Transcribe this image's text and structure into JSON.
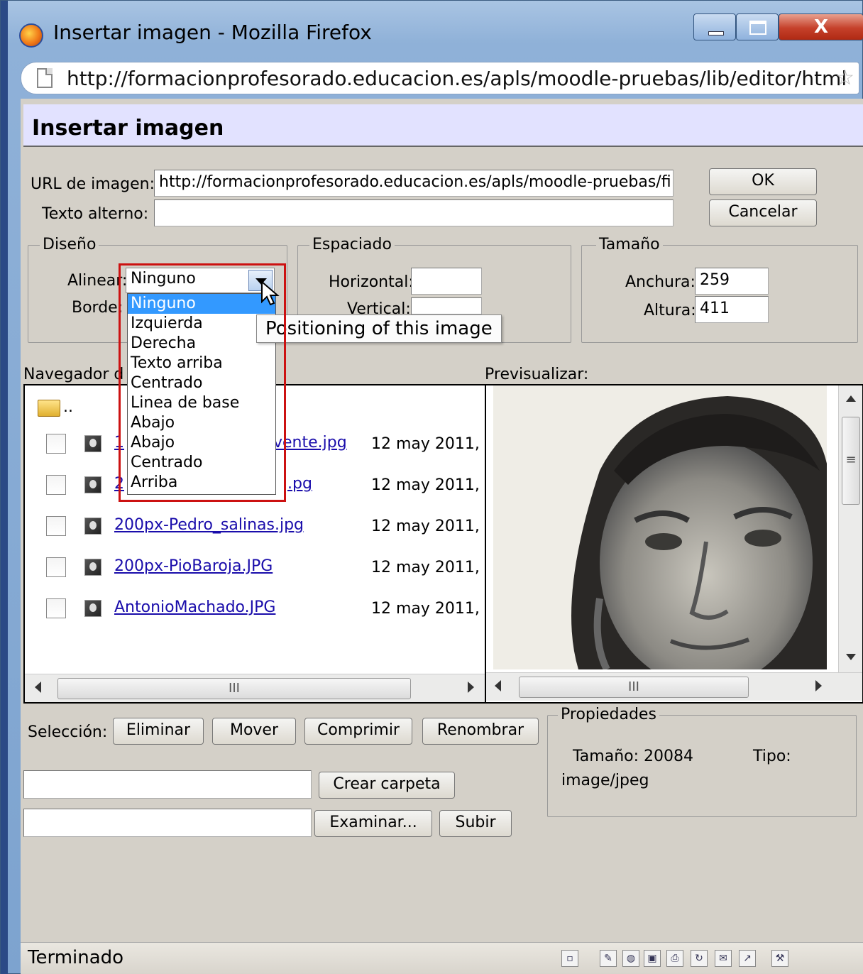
{
  "window": {
    "title": "Insertar imagen - Mozilla Firefox",
    "minimize_label": "",
    "maximize_label": "",
    "close_label": "X"
  },
  "urlbar": {
    "url": "http://formacionprofesorado.educacion.es/apls/moodle-pruebas/lib/editor/html"
  },
  "dialog": {
    "title": "Insertar imagen",
    "url_label": "URL de imagen:",
    "url_value": "http://formacionprofesorado.educacion.es/apls/moodle-pruebas/fi",
    "alt_label": "Texto alterno:",
    "alt_value": "",
    "ok_label": "OK",
    "cancel_label": "Cancelar"
  },
  "diseno": {
    "legend": "Diseño",
    "align_label": "Alinear:",
    "align_value": "Ninguno",
    "border_label": "Borde:",
    "align_options": [
      "Ninguno",
      "Izquierda",
      "Derecha",
      "Texto arriba",
      "Centrado",
      "Linea de base",
      "Abajo",
      "Abajo",
      "Centrado",
      "Arriba"
    ],
    "selected_option": "Ninguno"
  },
  "tooltip": "Positioning of this image",
  "espaciado": {
    "legend": "Espaciado",
    "horizontal_label": "Horizontal:",
    "vertical_label": "Vertical:",
    "horizontal_value": "",
    "vertical_value": ""
  },
  "tamano": {
    "legend": "Tamaño",
    "width_label": "Anchura:",
    "width_value": "259",
    "height_label": "Altura:",
    "height_value": "411"
  },
  "browser": {
    "label": "Navegador d",
    "parent_dir": "..",
    "files": [
      {
        "name_visible": "1",
        "name_tail": "vente.jpg",
        "date": "12 may 2011,"
      },
      {
        "name_visible": "2",
        "name_tail": ".pg",
        "date": "12 may 2011,"
      },
      {
        "name_visible": "200px-Pedro_salinas.jpg",
        "name_tail": "",
        "date": "12 may 2011,"
      },
      {
        "name_visible": "200px-PioBaroja.JPG",
        "name_tail": "",
        "date": "12 may 2011,"
      },
      {
        "name_visible": "AntonioMachado.JPG",
        "name_tail": "",
        "date": "12 may 2011,"
      }
    ],
    "scroll_grip": "III"
  },
  "preview": {
    "label": "Previsualizar:",
    "scroll_grip": "III",
    "vscroll_grip": "≡"
  },
  "seleccion": {
    "label": "Selección:",
    "delete": "Eliminar",
    "move": "Mover",
    "compress": "Comprimir",
    "rename": "Renombrar"
  },
  "propiedades": {
    "legend": "Propiedades",
    "size_label": "Tamaño: 20084",
    "type_label": "Tipo:",
    "type_value": "image/jpeg"
  },
  "folder": {
    "new_folder_value": "",
    "create_folder": "Crear carpeta",
    "upload_value": "",
    "browse": "Examinar...",
    "upload": "Subir"
  },
  "status": {
    "text": "Terminado",
    "icons": [
      "page-icon",
      "pencil-icon",
      "globe-icon",
      "save-icon",
      "print-icon",
      "refresh-icon",
      "mail-icon",
      "chart-icon",
      "tools-icon"
    ]
  }
}
